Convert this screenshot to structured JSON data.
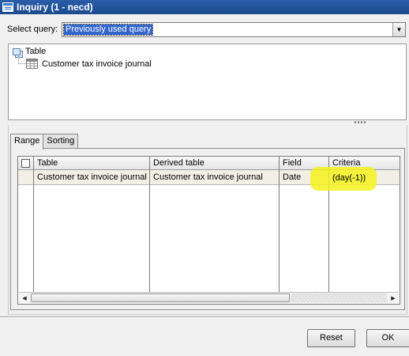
{
  "window": {
    "title": "Inquiry (1 - necd)"
  },
  "query": {
    "label": "Select query:",
    "selected": "Previously used query"
  },
  "tree": {
    "root_label": "Table",
    "child_label": "Customer tax invoice journal"
  },
  "tabs": [
    {
      "label": "Range",
      "active": true
    },
    {
      "label": "Sorting",
      "active": false
    }
  ],
  "grid": {
    "columns": [
      "Table",
      "Derived table",
      "Field",
      "Criteria"
    ],
    "rows": [
      {
        "table": "Customer tax invoice journal",
        "derived_table": "Customer tax invoice journal",
        "field": "Date",
        "criteria": "(day(-1))"
      }
    ]
  },
  "buttons": {
    "reset": "Reset",
    "ok": "OK"
  },
  "colors": {
    "titlebar": "#1c4a8e",
    "selection": "#3366cc",
    "row_background": "#f2f0e4",
    "criteria_highlight": "#f4f21c"
  },
  "icons": {
    "window": "inquiry-window-icon",
    "tree_root": "stacked-tables-icon",
    "tree_child": "table-grid-icon",
    "combo": "chevron-down-icon",
    "scroll_left": "scroll-left-arrow-icon",
    "scroll_right": "scroll-right-arrow-icon"
  }
}
